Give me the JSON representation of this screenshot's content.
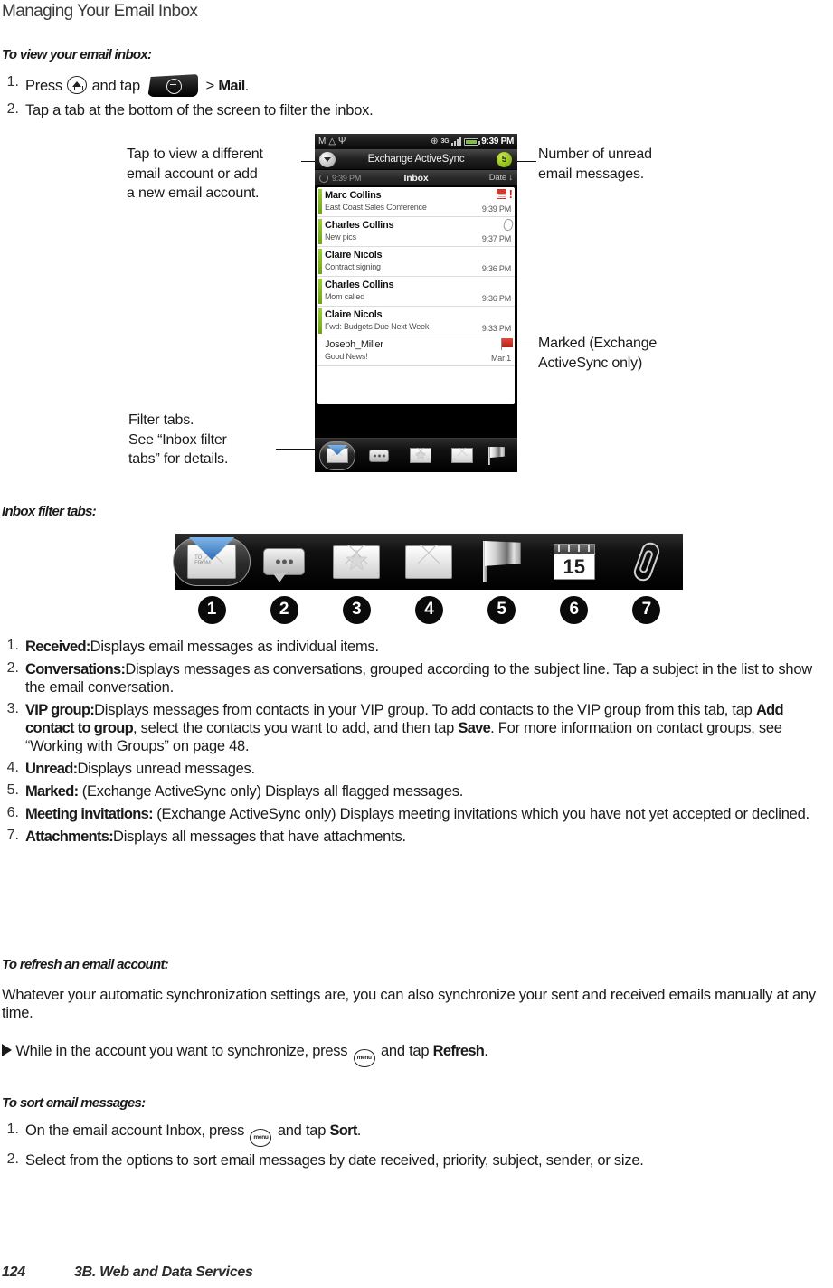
{
  "page": {
    "title": "Managing Your Email Inbox",
    "footer_page_number": "124",
    "footer_section": "3B. Web and Data Services"
  },
  "sections": {
    "view_inbox": {
      "heading": "To view your email inbox:",
      "steps": [
        {
          "num": "1.",
          "pre": "Press",
          "mid": "and tap",
          "post": "> ",
          "bold": "Mail",
          "end": "."
        },
        {
          "num": "2.",
          "text": "Tap a tab at the bottom of the screen to filter the inbox."
        }
      ]
    },
    "filter_tabs": {
      "heading": "Inbox filter tabs:"
    },
    "refresh": {
      "heading": "To refresh an email account:",
      "paragraph": "Whatever your automatic synchronization settings are, you can also synchronize your sent and received emails manually at any time.",
      "bullet_pre": "While in the account you want to synchronize, press",
      "bullet_mid": "and tap",
      "bullet_bold": "Refresh",
      "bullet_end": "."
    },
    "sort": {
      "heading": "To sort email messages:",
      "steps": [
        {
          "num": "1.",
          "pre": "On the email account Inbox, press",
          "mid": "and tap",
          "bold": "Sort",
          "end": "."
        },
        {
          "num": "2.",
          "text": "Select from the options to sort email messages by date received, priority, subject, sender, or size."
        }
      ]
    }
  },
  "callouts": {
    "account_switch": "Tap to view a different\nemail account or add\na new email account.",
    "unread_count": "Number of unread\nemail messages.",
    "marked": "Marked (Exchange\nActiveSync only)",
    "filter_tabs": "Filter tabs.\nSee “Inbox filter\ntabs” for details."
  },
  "phone": {
    "status_bar": {
      "icons": [
        "gmail-icon",
        "alert-icon",
        "usb-icon",
        "gps-icon"
      ],
      "network": "3G",
      "time": "9:39 PM"
    },
    "account_bar": {
      "title": "Exchange ActiveSync",
      "unread_badge": "5"
    },
    "folder_bar": {
      "sync_time": "9:39 PM",
      "folder": "Inbox",
      "sort": "Date"
    },
    "messages": [
      {
        "from": "Marc Collins",
        "subject": "East Coast Sales Conference",
        "time": "9:39 PM",
        "unread": true,
        "icons": [
          "calendar-icon",
          "priority-icon"
        ]
      },
      {
        "from": "Charles Collins",
        "subject": "New pics",
        "time": "9:37 PM",
        "unread": true,
        "icons": [
          "attachment-icon"
        ]
      },
      {
        "from": "Claire Nicols",
        "subject": "Contract signing",
        "time": "9:36 PM",
        "unread": true,
        "icons": []
      },
      {
        "from": "Charles Collins",
        "subject": "Mom called",
        "time": "9:36 PM",
        "unread": true,
        "icons": []
      },
      {
        "from": "Claire Nicols",
        "subject": "Fwd: Budgets Due Next Week",
        "time": "9:33 PM",
        "unread": true,
        "icons": []
      },
      {
        "from": "Joseph_Miller",
        "subject": "Good News!",
        "time": "Mar 1",
        "unread": false,
        "icons": [
          "flag-icon"
        ]
      }
    ]
  },
  "filter_tab_strip": {
    "tabs": [
      {
        "number": "1",
        "icon": "received-envelope-icon",
        "selected": true
      },
      {
        "number": "2",
        "icon": "conversations-bubble-icon",
        "selected": false
      },
      {
        "number": "3",
        "icon": "vip-star-envelope-icon",
        "selected": false
      },
      {
        "number": "4",
        "icon": "unread-envelope-icon",
        "selected": false
      },
      {
        "number": "5",
        "icon": "marked-flag-icon",
        "selected": false
      },
      {
        "number": "6",
        "icon": "meeting-calendar-icon",
        "selected": false,
        "day": "15"
      },
      {
        "number": "7",
        "icon": "attachments-paperclip-icon",
        "selected": false
      }
    ]
  },
  "tab_descriptions": [
    {
      "num": "1.",
      "term": "Received:",
      "text": "Displays email messages as individual items."
    },
    {
      "num": "2.",
      "term": "Conversations:",
      "text": "Displays messages as conversations, grouped according to the subject line. Tap a subject in the list to show the email conversation."
    },
    {
      "num": "3.",
      "term": "VIP group:",
      "text_a": "Displays messages from contacts in your VIP group. To add contacts to the VIP group from this tab, tap ",
      "bold_a": "Add contact to group",
      "text_b": ", select the contacts you want to add, and then tap ",
      "bold_b": "Save",
      "text_c": ". For more information on contact groups, see “Working with Groups” on page 48."
    },
    {
      "num": "4.",
      "term": "Unread:",
      "text": "Displays unread messages."
    },
    {
      "num": "5.",
      "term": "Marked:",
      "text": "(Exchange ActiveSync only) Displays all flagged messages."
    },
    {
      "num": "6.",
      "term": "Meeting invitations:",
      "text": "(Exchange ActiveSync only) Displays meeting invitations which you have not yet accepted or declined."
    },
    {
      "num": "7.",
      "term": "Attachments:",
      "text": "Displays all messages that have attachments."
    }
  ]
}
